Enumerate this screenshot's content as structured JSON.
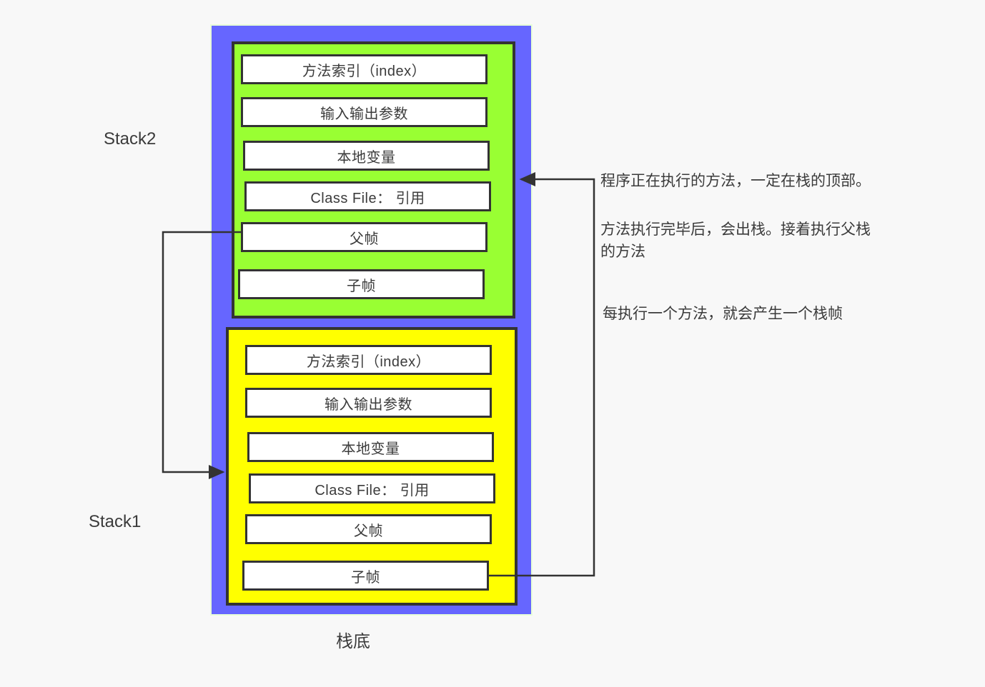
{
  "diagram": {
    "title_caption": "栈底",
    "background_color": "#f8f8f8",
    "container_color": "#6666ff",
    "border_color": "#333333",
    "stacks": [
      {
        "id": "stack2",
        "label": "Stack2",
        "color": "#99ff33",
        "frames": [
          "方法索引（index）",
          "输入输出参数",
          "本地变量",
          "Class File： 引用",
          "父帧",
          "子帧"
        ]
      },
      {
        "id": "stack1",
        "label": "Stack1",
        "color": "#ffff00",
        "frames": [
          "方法索引（index）",
          "输入输出参数",
          "本地变量",
          "Class File： 引用",
          "父帧",
          "子帧"
        ]
      }
    ],
    "annotations": [
      "程序正在执行的方法，一定在栈的顶部。",
      "方法执行完毕后，会出栈。接着执行父栈\n的方法",
      "每执行一个方法，就会产生一个栈帧"
    ]
  }
}
